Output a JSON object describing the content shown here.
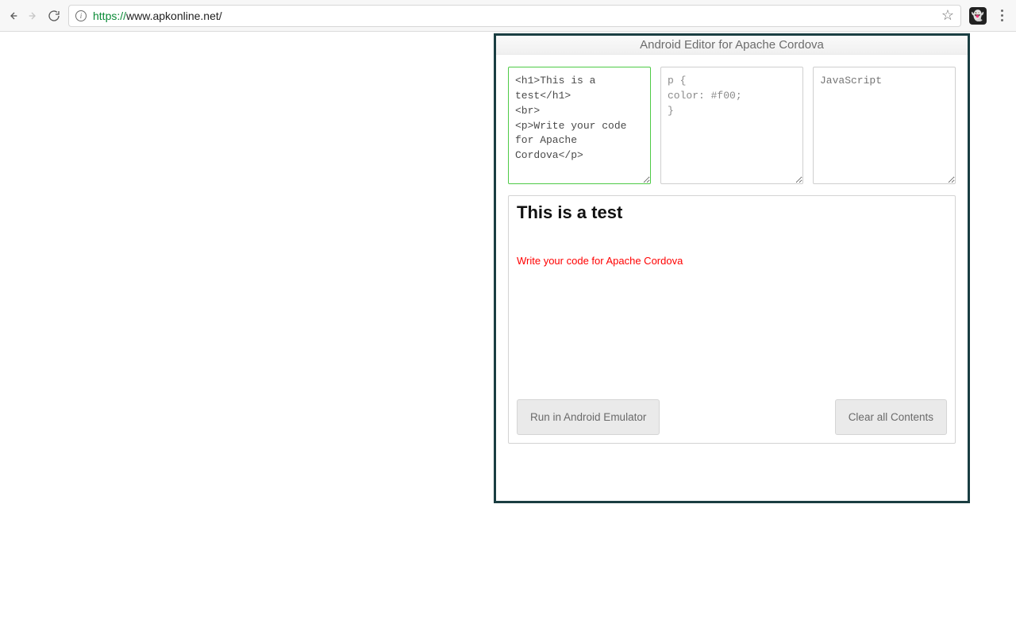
{
  "browser": {
    "url_scheme": "https://",
    "url_rest": "www.apkonline.net/"
  },
  "editor": {
    "title": "Android Editor for Apache Cordova",
    "html_code": "<h1>This is a test</h1>\n<br>\n<p>Write your code for Apache Cordova</p>",
    "css_code": "p {\ncolor: #f00;\n}",
    "js_placeholder": "JavaScript",
    "js_code": "",
    "preview_heading": "This is a test",
    "preview_paragraph": "Write your code for Apache Cordova",
    "run_button": "Run in Android Emulator",
    "clear_button": "Clear all Contents"
  }
}
